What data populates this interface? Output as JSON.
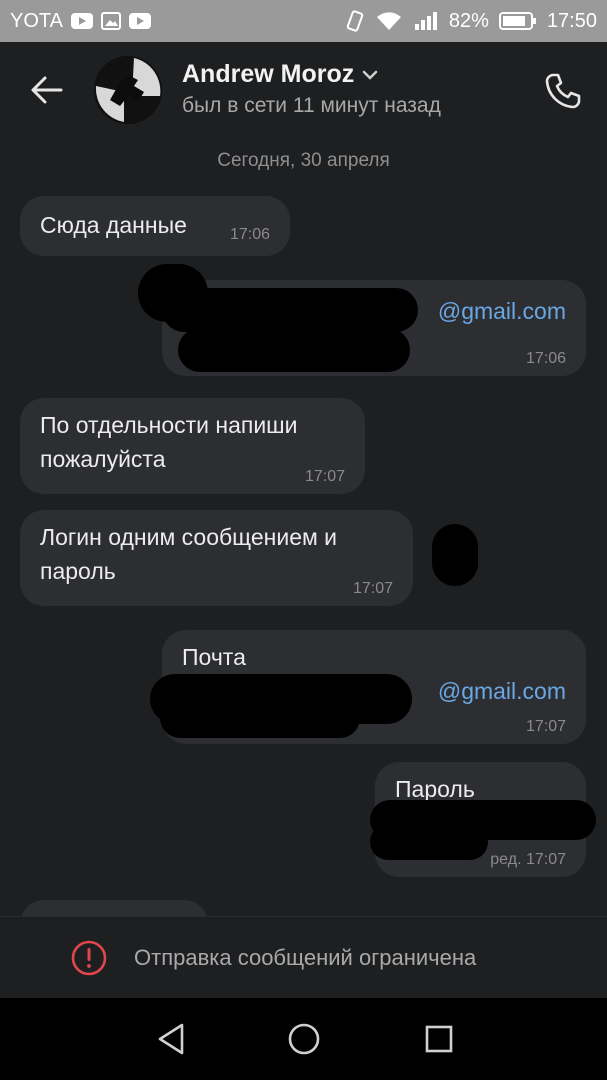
{
  "status_bar": {
    "carrier": "YOTA",
    "battery": "82%",
    "time": "17:50"
  },
  "header": {
    "contact_name": "Andrew Moroz",
    "last_seen": "был в сети 11 минут назад"
  },
  "chat": {
    "date_separator": "Сегодня, 30 апреля",
    "messages": [
      {
        "direction": "incoming",
        "lines": [
          "Сюда данные"
        ],
        "time": "17:06"
      },
      {
        "direction": "outgoing",
        "lines": [
          "@gmail.com"
        ],
        "time": "17:06"
      },
      {
        "direction": "incoming",
        "lines": [
          "По отдельности напиши",
          "пожалуйста"
        ],
        "time": "17:07"
      },
      {
        "direction": "incoming",
        "lines": [
          "Логин одним сообщением и",
          "пароль"
        ],
        "time": "17:07"
      },
      {
        "direction": "outgoing",
        "lines": [
          "Почта",
          "@gmail.com"
        ],
        "time": "17:07"
      },
      {
        "direction": "outgoing",
        "lines": [
          "Пароль"
        ],
        "time": "ред. 17:07"
      }
    ]
  },
  "composer": {
    "restricted_text": "Отправка сообщений ограничена"
  },
  "colors": {
    "background": "#1e1f21",
    "bubble": "#2d2e31",
    "link": "#6aa7e4",
    "warning": "#e0474c"
  },
  "icons": {
    "back": "arrow-left-icon",
    "call": "phone-icon",
    "warning": "exclamation-circle-icon",
    "nav_back": "triangle-back-icon",
    "nav_home": "circle-home-icon",
    "nav_recent": "square-recent-icon"
  }
}
